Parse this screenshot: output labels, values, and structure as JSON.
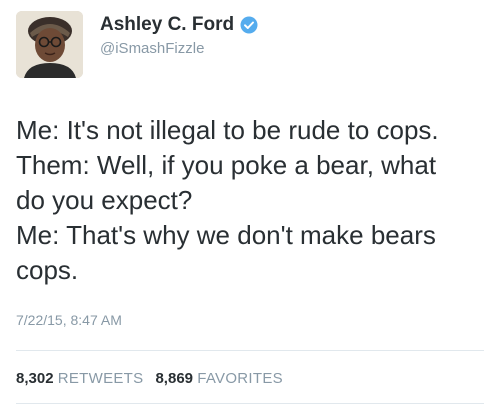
{
  "user": {
    "name": "Ashley C. Ford",
    "handle": "@iSmashFizzle",
    "avatar_icon": "profile-avatar",
    "verified_icon": "verified-badge-icon",
    "verified_color": "#55acee"
  },
  "tweet": {
    "lines": [
      "Me: It's not illegal to be rude to cops.",
      "Them: Well, if you poke a bear, what",
      "do you expect?",
      "Me: That's why we don't make bears",
      "cops."
    ],
    "timestamp": "7/22/15, 8:47 AM"
  },
  "stats": {
    "retweets_count": "8,302",
    "retweets_label": "RETWEETS",
    "favorites_count": "8,869",
    "favorites_label": "FAVORITES"
  }
}
